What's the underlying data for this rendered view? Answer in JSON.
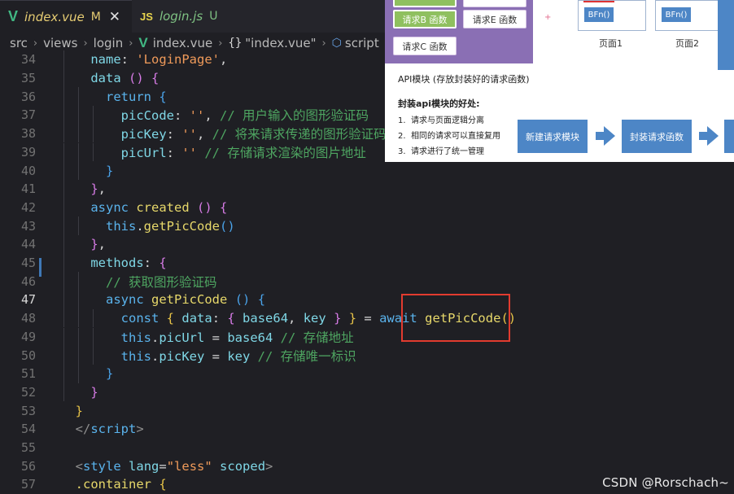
{
  "tabs": [
    {
      "icon": "V",
      "label": "index.vue",
      "status": "M",
      "close": "✕"
    },
    {
      "icon": "JS",
      "label": "login.js",
      "status": "U"
    }
  ],
  "breadcrumb": {
    "items": [
      "src",
      "views",
      "login",
      "index.vue",
      "\"index.vue\"",
      "script"
    ],
    "braces": "{}",
    "separator": "›"
  },
  "editor": {
    "lines": [
      {
        "n": "34",
        "segs": [
          [
            "pu",
            "    "
          ],
          [
            "pr",
            "name"
          ],
          [
            "pu",
            ": "
          ],
          [
            "st",
            "'LoginPage'"
          ],
          [
            "pu",
            ","
          ]
        ]
      },
      {
        "n": "35",
        "segs": [
          [
            "pu",
            "    "
          ],
          [
            "pr",
            "data"
          ],
          [
            "pu",
            " "
          ],
          [
            "br2",
            "()"
          ],
          [
            "pu",
            " "
          ],
          [
            "br2",
            "{"
          ]
        ]
      },
      {
        "n": "36",
        "segs": [
          [
            "pu",
            "      "
          ],
          [
            "kw",
            "return"
          ],
          [
            "pu",
            " "
          ],
          [
            "br3",
            "{"
          ]
        ]
      },
      {
        "n": "37",
        "segs": [
          [
            "pu",
            "        "
          ],
          [
            "pr",
            "picCode"
          ],
          [
            "pu",
            ": "
          ],
          [
            "st",
            "''"
          ],
          [
            "pu",
            ", "
          ],
          [
            "cm",
            "// 用户输入的图形验证码"
          ]
        ]
      },
      {
        "n": "38",
        "segs": [
          [
            "pu",
            "        "
          ],
          [
            "pr",
            "picKey"
          ],
          [
            "pu",
            ": "
          ],
          [
            "st",
            "''"
          ],
          [
            "pu",
            ", "
          ],
          [
            "cm",
            "// 将来请求传递的图形验证码"
          ]
        ]
      },
      {
        "n": "39",
        "segs": [
          [
            "pu",
            "        "
          ],
          [
            "pr",
            "picUrl"
          ],
          [
            "pu",
            ": "
          ],
          [
            "st",
            "''"
          ],
          [
            "pu",
            " "
          ],
          [
            "cm",
            "// 存储请求渲染的图片地址"
          ]
        ]
      },
      {
        "n": "40",
        "segs": [
          [
            "pu",
            "      "
          ],
          [
            "br3",
            "}"
          ]
        ]
      },
      {
        "n": "41",
        "segs": [
          [
            "pu",
            "    "
          ],
          [
            "br2",
            "}"
          ],
          [
            "pu",
            ","
          ]
        ]
      },
      {
        "n": "42",
        "segs": [
          [
            "pu",
            "    "
          ],
          [
            "kw",
            "async"
          ],
          [
            "pu",
            " "
          ],
          [
            "fn",
            "created"
          ],
          [
            "pu",
            " "
          ],
          [
            "br2",
            "()"
          ],
          [
            "pu",
            " "
          ],
          [
            "br2",
            "{"
          ]
        ]
      },
      {
        "n": "43",
        "segs": [
          [
            "pu",
            "      "
          ],
          [
            "th",
            "this"
          ],
          [
            "pu",
            "."
          ],
          [
            "fn",
            "getPicCode"
          ],
          [
            "br3",
            "()"
          ]
        ]
      },
      {
        "n": "44",
        "segs": [
          [
            "pu",
            "    "
          ],
          [
            "br2",
            "}"
          ],
          [
            "pu",
            ","
          ]
        ]
      },
      {
        "n": "45",
        "segs": [
          [
            "pu",
            "    "
          ],
          [
            "pr",
            "methods"
          ],
          [
            "pu",
            ": "
          ],
          [
            "br2",
            "{"
          ]
        ]
      },
      {
        "n": "46",
        "segs": [
          [
            "pu",
            "      "
          ],
          [
            "cm",
            "// 获取图形验证码"
          ]
        ]
      },
      {
        "n": "47",
        "segs": [
          [
            "pu",
            "      "
          ],
          [
            "kw",
            "async"
          ],
          [
            "pu",
            " "
          ],
          [
            "fn",
            "getPicCode"
          ],
          [
            "pu",
            " "
          ],
          [
            "br3",
            "()"
          ],
          [
            "pu",
            " "
          ],
          [
            "br3",
            "{"
          ]
        ]
      },
      {
        "n": "48",
        "segs": [
          [
            "pu",
            "        "
          ],
          [
            "kw",
            "const"
          ],
          [
            "pu",
            " "
          ],
          [
            "br1",
            "{"
          ],
          [
            "pu",
            " "
          ],
          [
            "sl",
            "data"
          ],
          [
            "pu",
            ": "
          ],
          [
            "br2",
            "{"
          ],
          [
            "pu",
            " "
          ],
          [
            "sl",
            "base64"
          ],
          [
            "pu",
            ", "
          ],
          [
            "sl",
            "key"
          ],
          [
            "pu",
            " "
          ],
          [
            "br2",
            "}"
          ],
          [
            "pu",
            " "
          ],
          [
            "br1",
            "}"
          ],
          [
            "pu",
            " = "
          ],
          [
            "kw",
            "await"
          ],
          [
            "pu",
            " "
          ],
          [
            "fn",
            "getPicCode"
          ],
          [
            "br1",
            "()"
          ]
        ]
      },
      {
        "n": "49",
        "segs": [
          [
            "pu",
            "        "
          ],
          [
            "th",
            "this"
          ],
          [
            "pu",
            "."
          ],
          [
            "pr",
            "picUrl"
          ],
          [
            "pu",
            " = "
          ],
          [
            "sl",
            "base64"
          ],
          [
            "pu",
            " "
          ],
          [
            "cm",
            "// 存储地址"
          ]
        ]
      },
      {
        "n": "50",
        "segs": [
          [
            "pu",
            "        "
          ],
          [
            "th",
            "this"
          ],
          [
            "pu",
            "."
          ],
          [
            "pr",
            "picKey"
          ],
          [
            "pu",
            " = "
          ],
          [
            "sl",
            "key"
          ],
          [
            "pu",
            " "
          ],
          [
            "cm",
            "// 存储唯一标识"
          ]
        ]
      },
      {
        "n": "51",
        "segs": [
          [
            "pu",
            "      "
          ],
          [
            "br3",
            "}"
          ]
        ]
      },
      {
        "n": "52",
        "segs": [
          [
            "pu",
            "    "
          ],
          [
            "br2",
            "}"
          ]
        ]
      },
      {
        "n": "53",
        "segs": [
          [
            "pu",
            "  "
          ],
          [
            "br1",
            "}"
          ]
        ]
      },
      {
        "n": "54",
        "segs": [
          [
            "pu",
            "  "
          ],
          [
            "tg",
            "</"
          ],
          [
            "tn",
            "script"
          ],
          [
            "tg",
            ">"
          ]
        ]
      },
      {
        "n": "55",
        "segs": []
      },
      {
        "n": "56",
        "segs": [
          [
            "pu",
            "  "
          ],
          [
            "tg",
            "<"
          ],
          [
            "tn",
            "style"
          ],
          [
            "pu",
            " "
          ],
          [
            "at",
            "lang"
          ],
          [
            "pu",
            "="
          ],
          [
            "st",
            "\"less\""
          ],
          [
            "pu",
            " "
          ],
          [
            "at",
            "scoped"
          ],
          [
            "tg",
            ">"
          ]
        ]
      },
      {
        "n": "57",
        "segs": [
          [
            "pu",
            "  "
          ],
          [
            "fn",
            ".container"
          ],
          [
            "pu",
            " "
          ],
          [
            "br1",
            "{"
          ]
        ]
      }
    ],
    "current_line": "47"
  },
  "slide": {
    "chips": [
      "请求B 函数",
      "请求E 函数",
      "请求C 函数"
    ],
    "plus": "+",
    "pages": [
      {
        "button": "BFn()",
        "label": "页面1"
      },
      {
        "button": "BFn()",
        "label": "页面2"
      }
    ],
    "api_title": "API模块 (存放封装好的请求函数)",
    "benefits_title": "封装api模块的好处:",
    "benefits": [
      {
        "n": "1.",
        "text": "请求与页面逻辑分离"
      },
      {
        "n": "2.",
        "text": "相同的请求可以直接复用"
      },
      {
        "n": "3.",
        "text": "请求进行了统一管理"
      }
    ],
    "steps": [
      "新建请求模块",
      "封装请求函数"
    ]
  },
  "watermark": "CSDN @Rorschach~"
}
